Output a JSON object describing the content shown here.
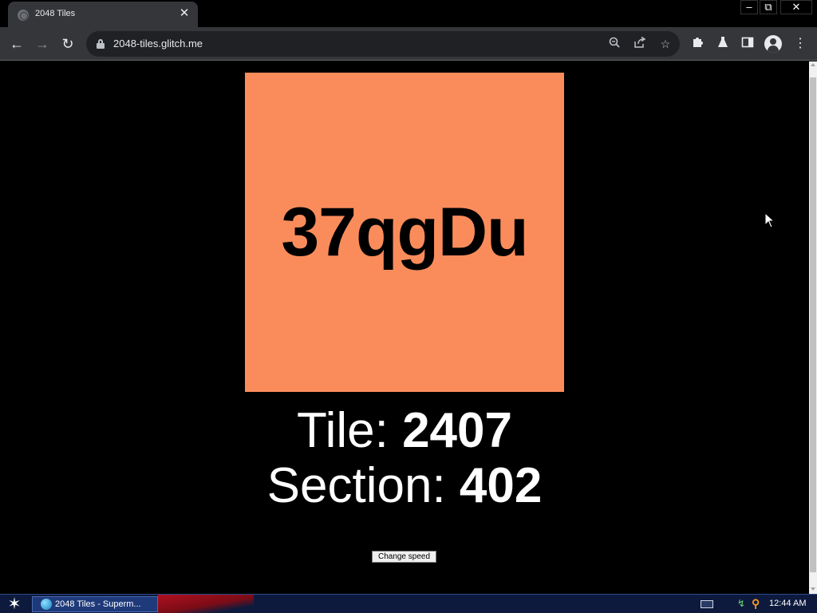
{
  "browser": {
    "tab_title": "2048 Tiles",
    "url": "2048-tiles.glitch.me",
    "window_controls": {
      "minimize": "–",
      "restore": "⧉",
      "close": "✕"
    }
  },
  "page": {
    "tile_text": "37qgDu",
    "tile_color": "#fa8c5c",
    "tile_label": "Tile: ",
    "tile_number": "2407",
    "section_label": "Section: ",
    "section_number": "402",
    "change_speed_label": "Change speed"
  },
  "taskbar": {
    "task_item_label": "2048 Tiles - Superm...",
    "clock": "12:44 AM"
  },
  "icons": {
    "back": "back-arrow-icon",
    "forward": "forward-arrow-icon",
    "reload": "reload-icon",
    "lock": "lock-icon",
    "zoom": "zoom-icon",
    "share": "share-icon",
    "star": "bookmark-star-icon",
    "extensions": "puzzle-icon",
    "labs": "flask-icon",
    "side_panel": "side-panel-icon",
    "profile": "profile-avatar-icon",
    "menu": "kebab-menu-icon"
  }
}
